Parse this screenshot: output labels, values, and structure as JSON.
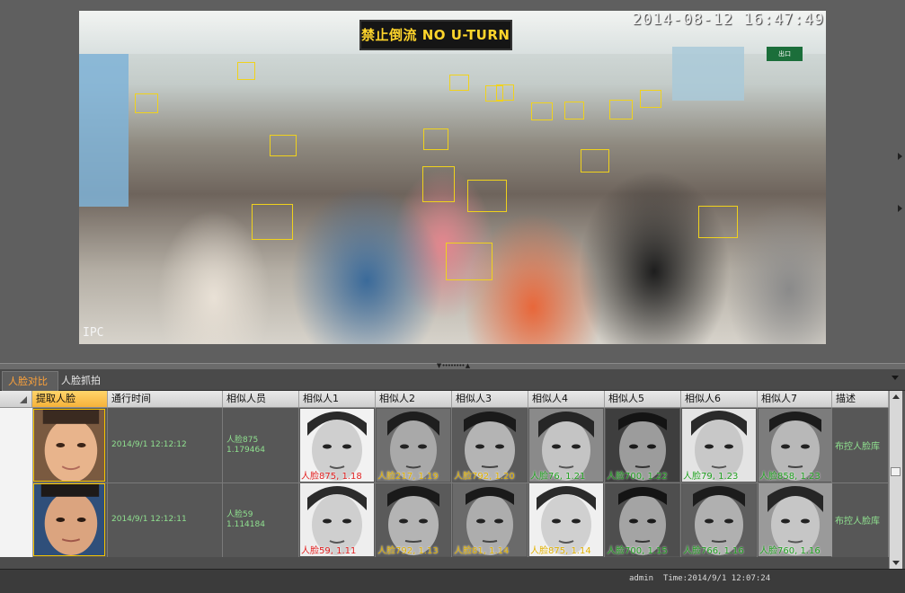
{
  "video": {
    "timestamp": "2014-08-12 16:47:49",
    "sign_text": "禁止倒流 NO U-TURNS",
    "exit_sign": "出口",
    "source_label": "IPC"
  },
  "tabs": [
    {
      "label": "人脸对比",
      "active": true
    },
    {
      "label": "人脸抓拍",
      "active": false
    }
  ],
  "table": {
    "headers": [
      "提取人脸",
      "通行时间",
      "相似人员",
      "相似人1",
      "相似人2",
      "相似人3",
      "相似人4",
      "相似人5",
      "相似人6",
      "相似人7",
      "描述"
    ],
    "rows": [
      {
        "pass_time": "2014/9/1 12:12:12",
        "similar_person": "人脸875",
        "similar_score": "1.179464",
        "matches": [
          {
            "label": "人脸875, 1.18",
            "color": "#e02020"
          },
          {
            "label": "人脸217, 1.19",
            "color": "#e0b000"
          },
          {
            "label": "人脸792, 1.20",
            "color": "#e0b000"
          },
          {
            "label": "人脸76, 1.21",
            "color": "#20a020"
          },
          {
            "label": "人脸700, 1.22",
            "color": "#20a020"
          },
          {
            "label": "人脸79, 1.23",
            "color": "#20a020"
          },
          {
            "label": "人脸858, 1.23",
            "color": "#20a020"
          }
        ],
        "description": "布控人脸库"
      },
      {
        "pass_time": "2014/9/1 12:12:11",
        "similar_person": "人脸59",
        "similar_score": "1.114184",
        "matches": [
          {
            "label": "人脸59, 1.11",
            "color": "#e02020"
          },
          {
            "label": "人脸792, 1.13",
            "color": "#e0b000"
          },
          {
            "label": "人脸81, 1.14",
            "color": "#e0b000"
          },
          {
            "label": "人脸875, 1.14",
            "color": "#e0b000"
          },
          {
            "label": "人脸700, 1.15",
            "color": "#20a020"
          },
          {
            "label": "人脸766, 1.16",
            "color": "#20a020"
          },
          {
            "label": "人脸760, 1.16",
            "color": "#20a020"
          }
        ],
        "description": "布控人脸库"
      }
    ]
  },
  "status": {
    "user": "admin",
    "time_label": "Time:",
    "time_value": "2014/9/1 12:07:24"
  },
  "colors": {
    "face_box": "#f0d21c",
    "active_tab": "#ffa33a",
    "text_green": "#8fe08f",
    "header_active": "#f6b23a"
  }
}
